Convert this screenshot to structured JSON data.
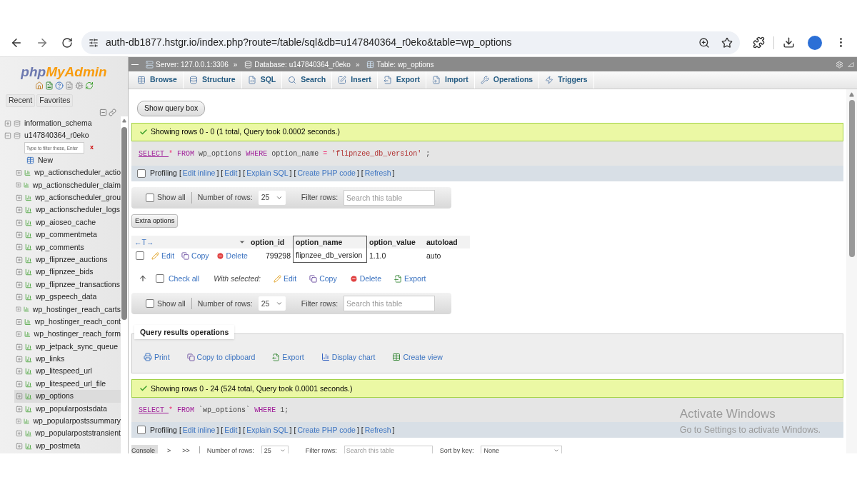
{
  "browser": {
    "url": "auth-db1877.hstgr.io/index.php?route=/table/sql&db=u147840364_r0eko&table=wp_options"
  },
  "sidebar": {
    "logo": [
      "php",
      "MyAdmin"
    ],
    "buttons": [
      "Recent",
      "Favorites"
    ],
    "tree": [
      {
        "label": "information_schema",
        "expanded": false
      },
      {
        "label": "u147840364_r0eko",
        "expanded": true,
        "filter_placeholder": "Type to filter these, Enter",
        "clear": "x",
        "children": [
          {
            "kind": "new",
            "label": "New",
            "selected": false
          },
          {
            "kind": "table",
            "label": "wp_actionscheduler_actio",
            "selected": false
          },
          {
            "kind": "table",
            "label": "wp_actionscheduler_claim",
            "selected": false
          },
          {
            "kind": "table",
            "label": "wp_actionscheduler_grou",
            "selected": false
          },
          {
            "kind": "table",
            "label": "wp_actionscheduler_logs",
            "selected": false
          },
          {
            "kind": "table",
            "label": "wp_aioseo_cache",
            "selected": false
          },
          {
            "kind": "table",
            "label": "wp_commentmeta",
            "selected": false
          },
          {
            "kind": "table",
            "label": "wp_comments",
            "selected": false
          },
          {
            "kind": "table",
            "label": "wp_flipnzee_auctions",
            "selected": false
          },
          {
            "kind": "table",
            "label": "wp_flipnzee_bids",
            "selected": false
          },
          {
            "kind": "table",
            "label": "wp_flipnzee_transactions",
            "selected": false
          },
          {
            "kind": "table",
            "label": "wp_gspeech_data",
            "selected": false
          },
          {
            "kind": "table",
            "label": "wp_hostinger_reach_carts",
            "selected": false
          },
          {
            "kind": "table",
            "label": "wp_hostinger_reach_cont",
            "selected": false
          },
          {
            "kind": "table",
            "label": "wp_hostinger_reach_form",
            "selected": false
          },
          {
            "kind": "table",
            "label": "wp_jetpack_sync_queue",
            "selected": false
          },
          {
            "kind": "table",
            "label": "wp_links",
            "selected": false
          },
          {
            "kind": "table",
            "label": "wp_litespeed_url",
            "selected": false
          },
          {
            "kind": "table",
            "label": "wp_litespeed_url_file",
            "selected": false
          },
          {
            "kind": "table",
            "label": "wp_options",
            "selected": true
          },
          {
            "kind": "table",
            "label": "wp_popularpostsdata",
            "selected": false
          },
          {
            "kind": "table",
            "label": "wp_popularpostssummary",
            "selected": false
          },
          {
            "kind": "table",
            "label": "wp_popularpoststransient",
            "selected": false
          },
          {
            "kind": "table",
            "label": "wp_postmeta",
            "selected": false
          }
        ]
      }
    ]
  },
  "breadcrumb": {
    "separator": "»",
    "items": [
      {
        "kind": "server",
        "text": "Server: 127.0.0.1:3306"
      },
      {
        "kind": "database",
        "text": "Database: u147840364_r0eko"
      },
      {
        "kind": "table",
        "text": "Table: wp_options"
      }
    ]
  },
  "tabs": [
    {
      "kind": "browse",
      "label": "Browse",
      "selected": false
    },
    {
      "kind": "structure",
      "label": "Structure",
      "selected": false
    },
    {
      "kind": "sql",
      "label": "SQL",
      "selected": false
    },
    {
      "kind": "search",
      "label": "Search",
      "selected": false
    },
    {
      "kind": "insert",
      "label": "Insert",
      "selected": false
    },
    {
      "kind": "export",
      "label": "Export",
      "selected": false
    },
    {
      "kind": "import",
      "label": "Import",
      "selected": false
    },
    {
      "kind": "operations",
      "label": "Operations",
      "selected": false
    },
    {
      "kind": "triggers",
      "label": "Triggers",
      "selected": false
    }
  ],
  "show_query_box": "Show query box",
  "query_1": {
    "message": "Showing rows 0 - 0 (1 total, Query took 0.0002 seconds.)",
    "sql": [
      {
        "kind": "keyword",
        "text": "SELECT"
      },
      {
        "kind": "operator",
        "text": "*"
      },
      {
        "kind": "keyword",
        "text": "FROM"
      },
      {
        "kind": "ident",
        "text": "wp_options"
      },
      {
        "kind": "keyword",
        "text": "WHERE"
      },
      {
        "kind": "ident",
        "text": "option_name"
      },
      {
        "kind": "operator",
        "text": "="
      },
      {
        "kind": "string",
        "text": "'flipnzee_db_version'"
      },
      {
        "kind": "ident",
        "text": ";"
      }
    ],
    "profiling": {
      "label": "Profiling",
      "checked": false,
      "brackets": [
        "[",
        "]"
      ],
      "links": [
        "Edit inline",
        "Edit",
        "Explain SQL",
        "Create PHP code",
        "Refresh"
      ]
    }
  },
  "grid_nav_top": {
    "show_all": {
      "label": "Show all",
      "checked": false
    },
    "rows_label": "Number of rows:",
    "rows_value": "25",
    "filter_label": "Filter rows:",
    "filter_placeholder": "Search this table"
  },
  "extra_options": "Extra options",
  "table": {
    "resize": "←T→",
    "columns": [
      {
        "label": "option_id",
        "highlighted": false
      },
      {
        "label": "option_name",
        "highlighted": true
      },
      {
        "label": "option_value",
        "highlighted": false
      },
      {
        "label": "autoload",
        "highlighted": false
      }
    ],
    "rows": [
      {
        "checked": false,
        "actions": [
          "Edit",
          "Copy",
          "Delete"
        ],
        "cells": [
          "799298",
          "flipnzee_db_version",
          "1.1.0",
          "auto"
        ]
      }
    ]
  },
  "bulk": {
    "check_all": {
      "label": "Check all",
      "checked": false
    },
    "with_selected": "With selected:",
    "actions": [
      {
        "kind": "edit",
        "label": "Edit"
      },
      {
        "kind": "copy",
        "label": "Copy"
      },
      {
        "kind": "delete",
        "label": "Delete"
      },
      {
        "kind": "export",
        "label": "Export"
      }
    ]
  },
  "grid_nav_bottom": {
    "show_all": {
      "label": "Show all",
      "checked": false
    },
    "rows_label": "Number of rows:",
    "rows_value": "25",
    "filter_label": "Filter rows:",
    "filter_placeholder": "Search this table"
  },
  "operations": {
    "legend": "Query results operations",
    "actions": [
      {
        "kind": "print",
        "label": "Print"
      },
      {
        "kind": "copy",
        "label": "Copy to clipboard"
      },
      {
        "kind": "export",
        "label": "Export"
      },
      {
        "kind": "chart",
        "label": "Display chart"
      },
      {
        "kind": "view",
        "label": "Create view"
      }
    ]
  },
  "query_2": {
    "message": "Showing rows 0 - 24 (524 total, Query took 0.0001 seconds.)",
    "sql": [
      {
        "kind": "keyword",
        "text": "SELECT"
      },
      {
        "kind": "operator",
        "text": "*"
      },
      {
        "kind": "keyword",
        "text": "FROM"
      },
      {
        "kind": "ident",
        "text": "`wp_options`"
      },
      {
        "kind": "keyword",
        "text": "WHERE"
      },
      {
        "kind": "number",
        "text": "1;"
      }
    ],
    "profiling": {
      "label": "Profiling",
      "checked": false,
      "brackets": [
        "[",
        "]"
      ],
      "links": [
        "Edit inline",
        "Edit",
        "Explain SQL",
        "Create PHP code",
        "Refresh"
      ]
    }
  },
  "bottom_bar": {
    "console": "Console",
    "pager": [
      ">",
      ">>"
    ],
    "rows_label": "Number of rows:",
    "rows_value": "25",
    "filter_label": "Filter rows:",
    "filter_placeholder": "Search this table",
    "sort_label": "Sort by key:",
    "sort_value": "None"
  },
  "watermark": {
    "title": "Activate Windows",
    "subtitle": "Go to Settings to activate Windows."
  }
}
